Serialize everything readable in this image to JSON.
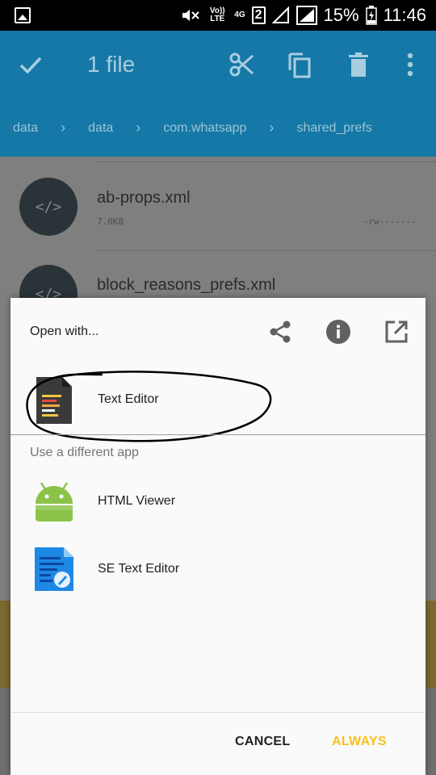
{
  "status_bar": {
    "volte": "Vo)) LTE",
    "network": "4G",
    "sim": "2",
    "battery": "15%",
    "time": "11:46"
  },
  "app_bar": {
    "title": "1 file",
    "icons": [
      "check-icon",
      "cut-icon",
      "copy-icon",
      "delete-icon",
      "more-vert-icon"
    ]
  },
  "breadcrumb": [
    "data",
    "data",
    "com.whatsapp",
    "shared_prefs"
  ],
  "files": [
    {
      "name": "ab-props.xml",
      "size": "7.0KB",
      "perm": "-rw-------"
    },
    {
      "name": "block_reasons_prefs.xml"
    }
  ],
  "dialog": {
    "title": "Open with...",
    "header_icons": [
      "share-icon",
      "info-icon",
      "open-external-icon"
    ],
    "primary_app": {
      "label": "Text Editor",
      "icon": "text-editor-icon"
    },
    "subheading": "Use a different app",
    "apps": [
      {
        "label": "HTML Viewer",
        "icon": "android-icon"
      },
      {
        "label": "SE Text Editor",
        "icon": "se-text-editor-icon"
      }
    ],
    "cancel": "CANCEL",
    "always": "ALWAYS"
  },
  "colors": {
    "app_bar": "#1578a6",
    "accent": "#f6c219",
    "dialog_bg": "#fafafa"
  }
}
